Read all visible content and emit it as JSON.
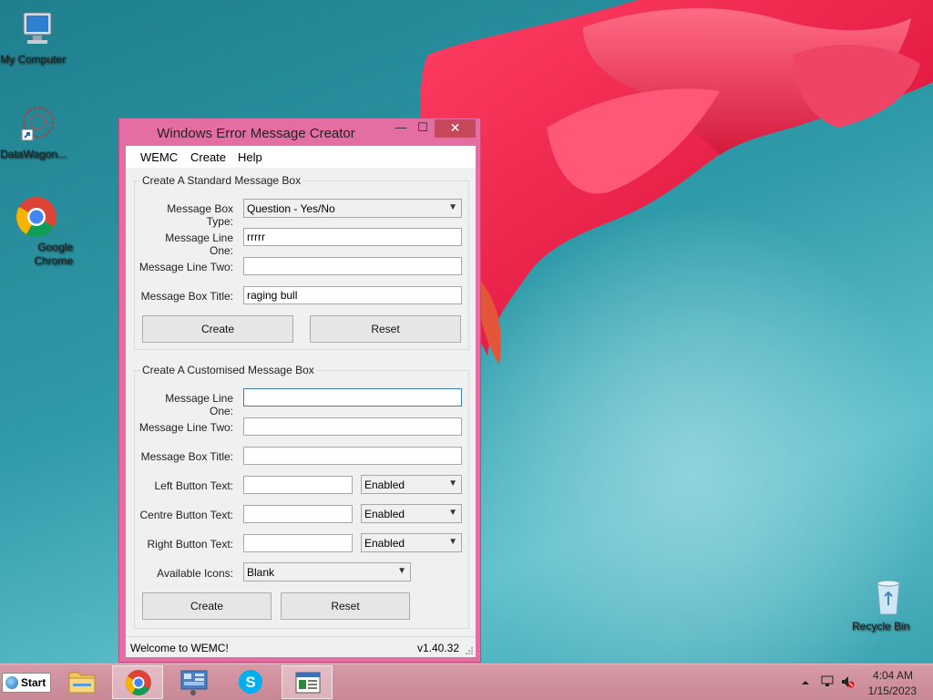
{
  "desktop": {
    "icons": [
      {
        "label": "My Computer"
      },
      {
        "label": "DataWagon..."
      },
      {
        "label": "Google Chrome"
      },
      {
        "label": "Recycle Bin"
      }
    ]
  },
  "window": {
    "title": "Windows Error Message Creator",
    "menu": [
      "WEMC",
      "Create",
      "Help"
    ],
    "standard": {
      "group_title": "Create A Standard Message Box",
      "type_label": "Message Box Type:",
      "type_value": "Question - Yes/No",
      "line1_label": "Message Line One:",
      "line1_value": "rrrrr",
      "line2_label": "Message Line Two:",
      "line2_value": "",
      "title_label": "Message Box Title:",
      "title_value": "raging bull",
      "create_label": "Create",
      "reset_label": "Reset"
    },
    "custom": {
      "group_title": "Create A Customised Message Box",
      "line1_label": "Message Line One:",
      "line1_value": "",
      "line2_label": "Message Line Two:",
      "line2_value": "",
      "title_label": "Message Box Title:",
      "title_value": "",
      "left_label": "Left Button Text:",
      "left_value": "",
      "left_state": "Enabled",
      "centre_label": "Centre Button Text:",
      "centre_value": "",
      "centre_state": "Enabled",
      "right_label": "Right Button Text:",
      "right_value": "",
      "right_state": "Enabled",
      "icons_label": "Available Icons:",
      "icons_value": "Blank",
      "create_label": "Create",
      "reset_label": "Reset"
    },
    "status_left": "Welcome to WEMC!",
    "status_right": "v1.40.32"
  },
  "taskbar": {
    "start_label": "Start",
    "clock_time": "4:04 AM",
    "clock_date": "1/15/2023"
  },
  "colors": {
    "window_frame": "#e46ea4",
    "close_button": "#c7485a",
    "taskbar": "#d79aa6"
  }
}
